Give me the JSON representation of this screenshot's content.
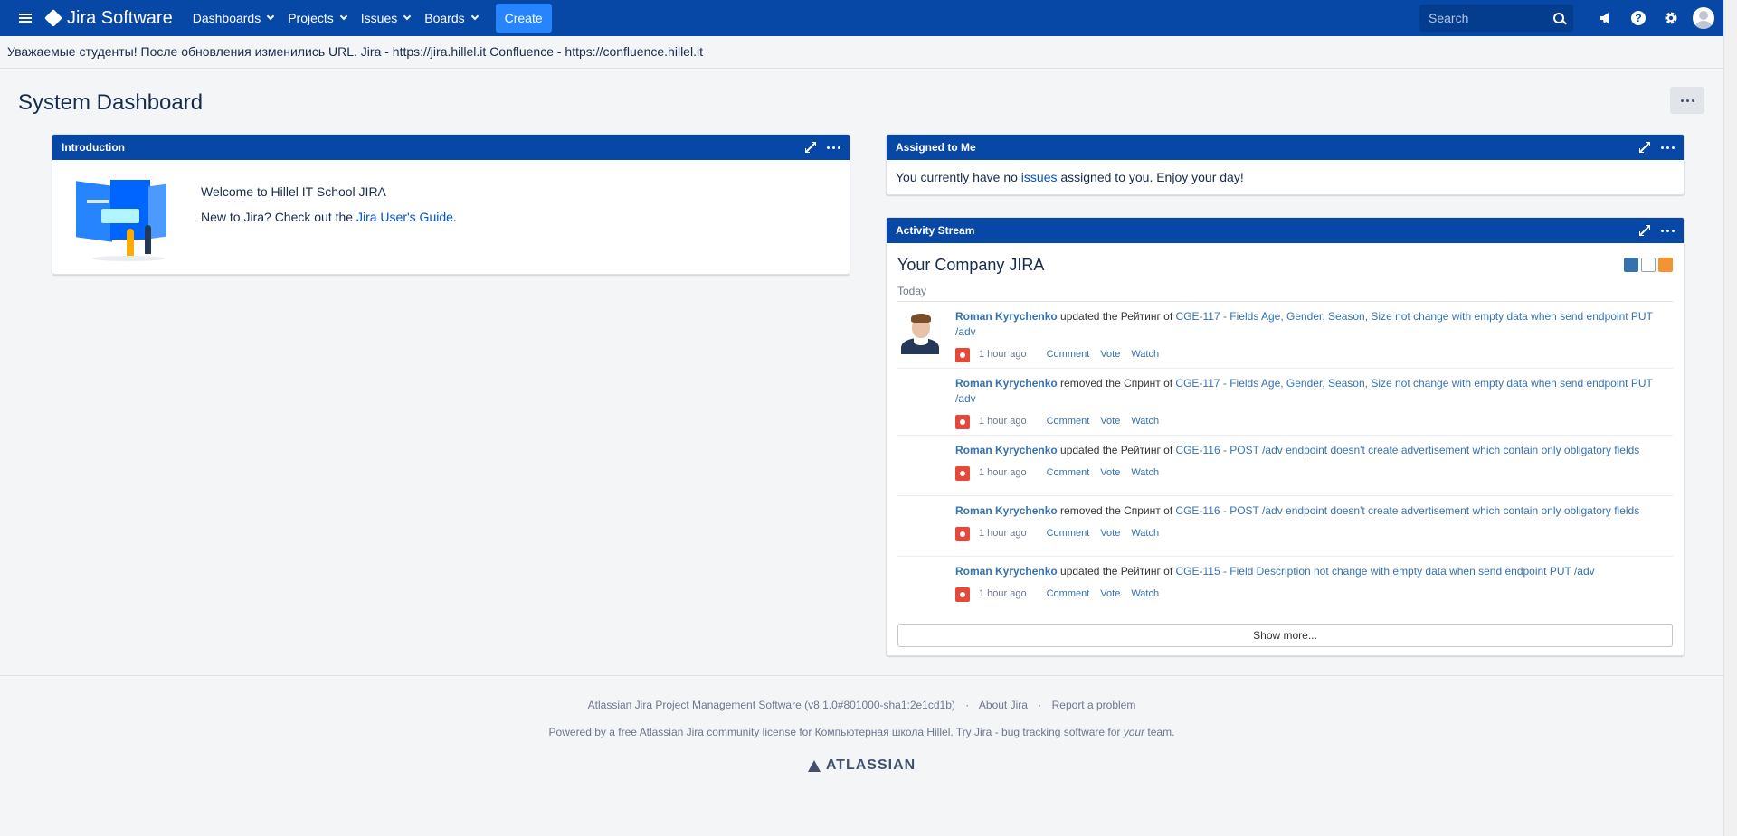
{
  "nav": {
    "logo_text": "Jira Software",
    "items": [
      {
        "label": "Dashboards"
      },
      {
        "label": "Projects"
      },
      {
        "label": "Issues"
      },
      {
        "label": "Boards"
      }
    ],
    "create_label": "Create",
    "search_placeholder": "Search",
    "icons": [
      "menu-icon",
      "jira-logo-icon",
      "search-icon",
      "megaphone-icon",
      "help-icon",
      "gear-icon",
      "avatar"
    ]
  },
  "announcement": "Уважаемые студенты! После обновления изменились URL. Jira - https://jira.hillel.it Confluence - https://confluence.hillel.it",
  "page": {
    "title": "System Dashboard"
  },
  "introduction": {
    "title": "Introduction",
    "welcome": "Welcome to Hillel IT School JIRA",
    "guide_prefix": "New to Jira? Check out the ",
    "guide_link": "Jira User's Guide",
    "guide_suffix": "."
  },
  "assigned": {
    "title": "Assigned to Me",
    "text_before": "You currently have no ",
    "link": "issues",
    "text_after": " assigned to you. Enjoy your day!"
  },
  "activity": {
    "title": "Activity Stream",
    "stream_title": "Your Company JIRA",
    "day": "Today",
    "items": [
      {
        "user": "Roman Kyrychenko",
        "action": " updated the Рейтинг of ",
        "issue": "CGE-117 - Fields Age, Gender, Season, Size not change with empty data when send endpoint PUT /adv",
        "time": "1 hour ago",
        "show_avatar": true
      },
      {
        "user": "Roman Kyrychenko",
        "action": " removed the Спринт of ",
        "issue": "CGE-117 - Fields Age, Gender, Season, Size not change with empty data when send endpoint PUT /adv",
        "time": "1 hour ago",
        "show_avatar": false
      },
      {
        "user": "Roman Kyrychenko",
        "action": " updated the Рейтинг of ",
        "issue": "CGE-116 - POST /adv endpoint doesn't create advertisement which contain only obligatory fields",
        "time": "1 hour ago",
        "show_avatar": false
      },
      {
        "user": "Roman Kyrychenko",
        "action": " removed the Спринт of ",
        "issue": "CGE-116 - POST /adv endpoint doesn't create advertisement which contain only obligatory fields",
        "time": "1 hour ago",
        "show_avatar": false
      },
      {
        "user": "Roman Kyrychenko",
        "action": " updated the Рейтинг of ",
        "issue": "CGE-115 - Field Description not change with empty data when send endpoint PUT /adv",
        "time": "1 hour ago",
        "show_avatar": false
      }
    ],
    "actions": {
      "comment": "Comment",
      "vote": "Vote",
      "watch": "Watch"
    },
    "show_more": "Show more..."
  },
  "footer": {
    "version": "Atlassian Jira Project Management Software (v8.1.0#801000-sha1:2e1cd1b)",
    "about": "About Jira",
    "report": "Report a problem",
    "powered_prefix": "Powered by a free Atlassian Jira community license for Компьютерная школа Hillel. Try Jira - bug tracking software for ",
    "powered_em": "your",
    "powered_suffix": " team.",
    "brand": "ATLASSIAN"
  },
  "colors": {
    "header": "#0747a6",
    "create_button": "#2684ff",
    "link": "#0052cc",
    "bug": "#e5493a"
  }
}
